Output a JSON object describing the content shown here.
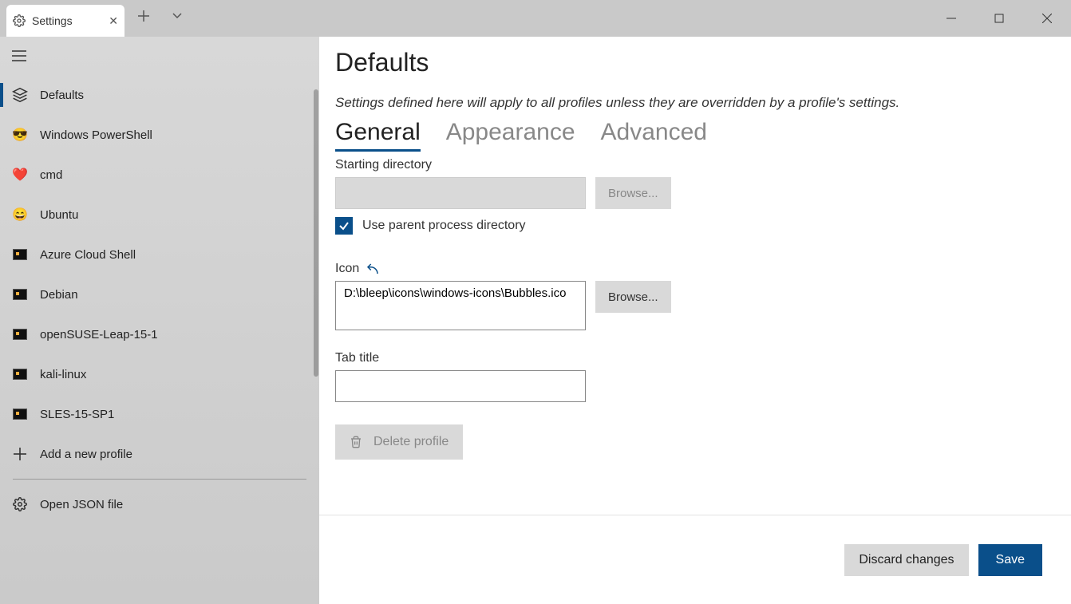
{
  "window": {
    "tab_title": "Settings"
  },
  "sidebar": {
    "items": [
      {
        "label": "Defaults",
        "icon": "layers",
        "selected": true
      },
      {
        "label": "Windows PowerShell",
        "icon": "emoji-cool"
      },
      {
        "label": "cmd",
        "icon": "heart"
      },
      {
        "label": "Ubuntu",
        "icon": "emoji-smile"
      },
      {
        "label": "Azure Cloud Shell",
        "icon": "profile-box"
      },
      {
        "label": "Debian",
        "icon": "profile-box"
      },
      {
        "label": "openSUSE-Leap-15-1",
        "icon": "profile-box"
      },
      {
        "label": "kali-linux",
        "icon": "profile-box"
      },
      {
        "label": "SLES-15-SP1",
        "icon": "profile-box"
      }
    ],
    "add_profile": "Add a new profile",
    "open_json": "Open JSON file"
  },
  "main": {
    "title": "Defaults",
    "description": "Settings defined here will apply to all profiles unless they are overridden by a profile's settings.",
    "tabs": [
      {
        "label": "General",
        "active": true
      },
      {
        "label": "Appearance"
      },
      {
        "label": "Advanced"
      }
    ],
    "starting_directory": {
      "label": "Starting directory",
      "value": "",
      "browse": "Browse...",
      "checkbox_label": "Use parent process directory",
      "checked": true
    },
    "icon": {
      "label": "Icon",
      "value": "D:\\bleep\\icons\\windows-icons\\Bubbles.ico",
      "browse": "Browse..."
    },
    "tab_title": {
      "label": "Tab title",
      "value": ""
    },
    "delete_label": "Delete profile"
  },
  "footer": {
    "discard": "Discard changes",
    "save": "Save"
  }
}
